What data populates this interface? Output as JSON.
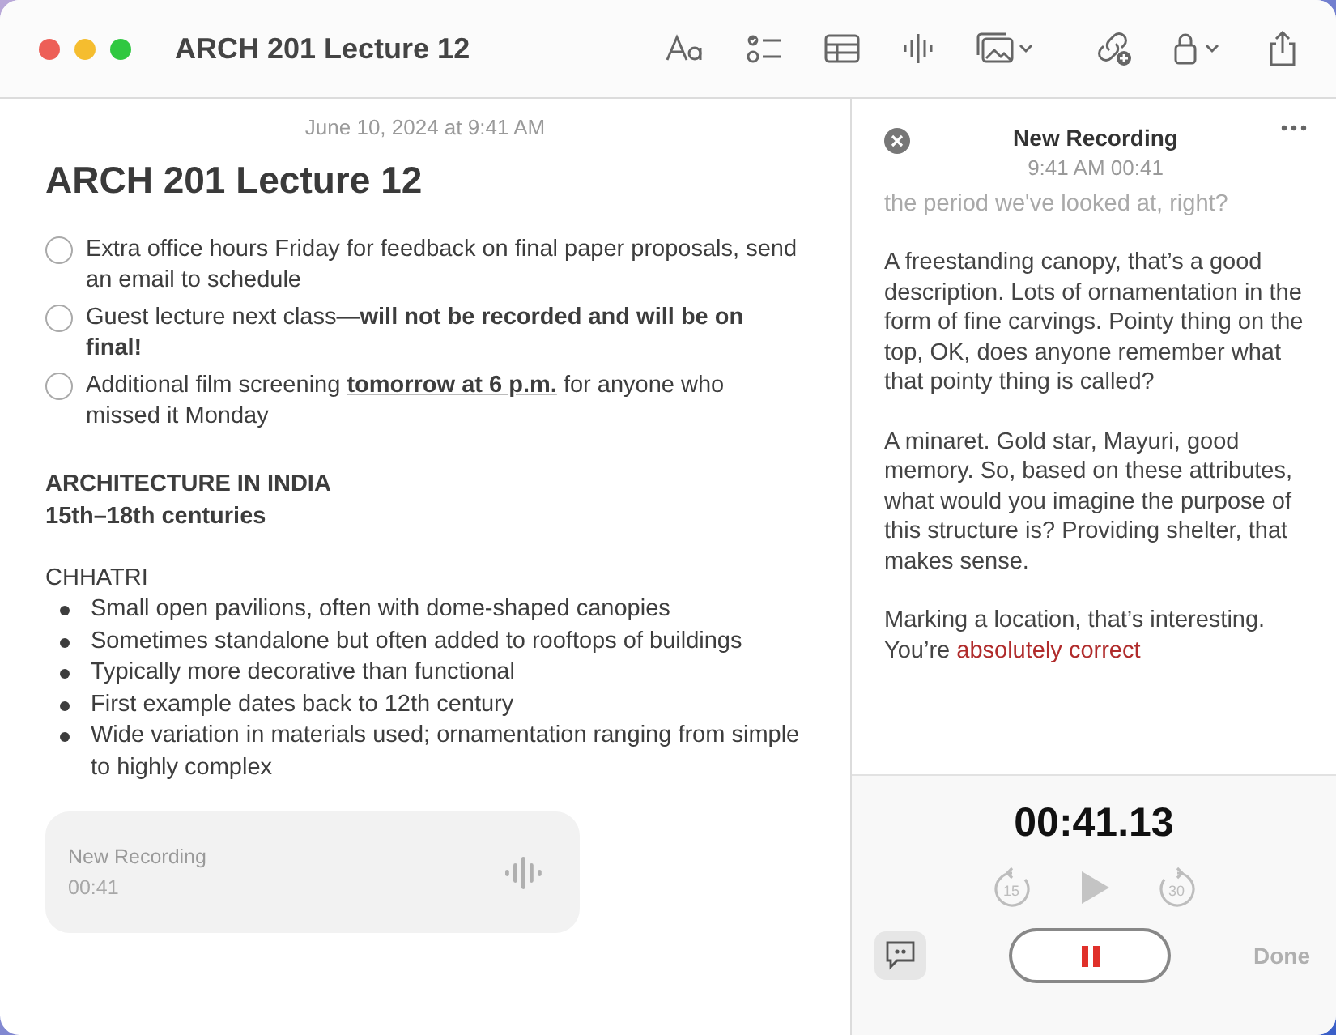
{
  "window": {
    "title": "ARCH 201 Lecture 12"
  },
  "note": {
    "date": "June 10, 2024 at 9:41 AM",
    "heading": "ARCH 201 Lecture 12",
    "checklist": [
      {
        "checked": false,
        "segments": [
          {
            "kind": "plain",
            "text": "Extra office hours Friday for feedback on final paper proposals, send an email to schedule"
          }
        ]
      },
      {
        "checked": false,
        "segments": [
          {
            "kind": "plain",
            "text": "Guest lecture next class—"
          },
          {
            "kind": "bold",
            "text": "will not be recorded and will be on final!"
          }
        ]
      },
      {
        "checked": false,
        "segments": [
          {
            "kind": "plain",
            "text": "Additional film screening "
          },
          {
            "kind": "link",
            "text": "tomorrow at 6 p.m."
          },
          {
            "kind": "plain",
            "text": " for anyone who missed it Monday"
          }
        ]
      }
    ],
    "section_title": "ARCHITECTURE IN INDIA",
    "section_subtitle": "15th–18th centuries",
    "subheading": "CHHATRI",
    "bullets": [
      "Small open pavilions, often with dome-shaped canopies",
      "Sometimes standalone but often added to rooftops of buildings",
      "Typically more decorative than functional",
      "First example dates back to 12th century",
      "Wide variation in materials used; ornamentation ranging from simple to highly complex"
    ],
    "attachment": {
      "title": "New Recording",
      "duration": "00:41"
    }
  },
  "recording": {
    "title": "New Recording",
    "subtitle": "9:41 AM 00:41",
    "faded_line": "the period we've looked at, right?",
    "paragraphs": [
      [
        {
          "highlight": false,
          "text": "A freestanding canopy, that’s a good description. Lots of ornamentation in the form of fine carvings. Pointy thing on the top, OK, does anyone remember what that pointy thing is called?"
        }
      ],
      [
        {
          "highlight": false,
          "text": "A minaret. Gold star, Mayuri, good memory. So, based on these attributes, what would you imagine the purpose of this structure is? Providing shelter, that makes sense."
        }
      ],
      [
        {
          "highlight": false,
          "text": "Marking a location, that’s interesting. You’re "
        },
        {
          "highlight": true,
          "text": "absolutely correct"
        }
      ]
    ],
    "timer": "00:41.13",
    "skip_back": "15",
    "skip_forward": "30",
    "playback_disabled": true,
    "recording": true,
    "done": {
      "label": "Done",
      "disabled": true
    }
  }
}
